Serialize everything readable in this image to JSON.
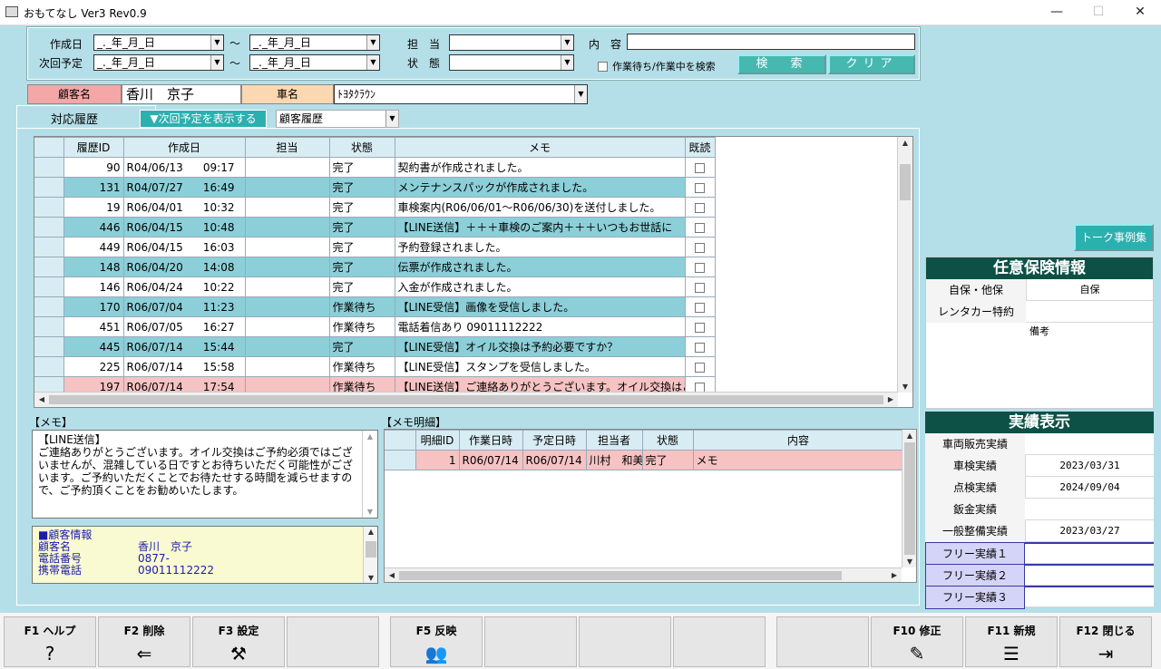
{
  "window": {
    "title": "おもてなし Ver3 Rev0.9",
    "min": "—",
    "max": "☐",
    "close": "✕"
  },
  "search": {
    "created_label": "作成日",
    "next_label": "次回予定",
    "date_placeholder": "_._年_月_日",
    "tilde": "〜",
    "staff_label": "担　当",
    "status_label": "状　態",
    "content_label": "内　容",
    "checkbox_label": "作業待ち/作業中を検索",
    "search_btn": "検　索",
    "clear_btn": "クリア"
  },
  "customer": {
    "name_label": "顧客名",
    "name_value": "香川　京子",
    "car_label": "車名",
    "car_value": "ﾄﾖﾀｸﾗｳﾝ"
  },
  "history": {
    "tab_label": "対応履歴",
    "show_next_btn": "▼次回予定を表示する",
    "filter_value": "顧客履歴",
    "columns": [
      "履歴ID",
      "作成日",
      "担当",
      "状態",
      "メモ",
      "既読"
    ],
    "rows": [
      {
        "id": "90",
        "date": "R04/06/13",
        "time": "09:17",
        "staff": "",
        "status": "完了",
        "memo": "契約書が作成されました。"
      },
      {
        "id": "131",
        "date": "R04/07/27",
        "time": "16:49",
        "staff": "",
        "status": "完了",
        "memo": "メンテナンスパックが作成されました。"
      },
      {
        "id": "19",
        "date": "R06/04/01",
        "time": "10:32",
        "staff": "",
        "status": "完了",
        "memo": "車検案内(R06/06/01〜R06/06/30)を送付しました。"
      },
      {
        "id": "446",
        "date": "R06/04/15",
        "time": "10:48",
        "staff": "",
        "status": "完了",
        "memo": "【LINE送信】＋＋＋車検のご案内＋＋＋いつもお世話に"
      },
      {
        "id": "449",
        "date": "R06/04/15",
        "time": "16:03",
        "staff": "",
        "status": "完了",
        "memo": "予約登録されました。"
      },
      {
        "id": "148",
        "date": "R06/04/20",
        "time": "14:08",
        "staff": "",
        "status": "完了",
        "memo": "伝票が作成されました。"
      },
      {
        "id": "146",
        "date": "R06/04/24",
        "time": "10:22",
        "staff": "",
        "status": "完了",
        "memo": "入金が作成されました。"
      },
      {
        "id": "170",
        "date": "R06/07/04",
        "time": "11:23",
        "staff": "",
        "status": "作業待ち",
        "memo": "【LINE受信】画像を受信しました。"
      },
      {
        "id": "451",
        "date": "R06/07/05",
        "time": "16:27",
        "staff": "",
        "status": "作業待ち",
        "memo": "電話着信あり 09011112222"
      },
      {
        "id": "445",
        "date": "R06/07/14",
        "time": "15:44",
        "staff": "",
        "status": "完了",
        "memo": "【LINE受信】オイル交換は予約必要ですか？"
      },
      {
        "id": "225",
        "date": "R06/07/14",
        "time": "15:58",
        "staff": "",
        "status": "作業待ち",
        "memo": "【LINE受信】スタンプを受信しました。"
      },
      {
        "id": "197",
        "date": "R06/07/14",
        "time": "17:54",
        "staff": "",
        "status": "作業待ち",
        "memo": "【LINE送信】ご連絡ありがとうございます。オイル交換はご"
      }
    ]
  },
  "memo": {
    "label": "【メモ】",
    "text": "【LINE送信】\nご連絡ありがとうございます。オイル交換はご予約必須ではございませんが、混雑している日ですとお待ちいただく可能性がございます。ご予約いただくことでお待たせする時間を減らせますので、ご予約頂くことをお勧めいたします。"
  },
  "customer_info": {
    "title": "■顧客情報",
    "rows": [
      {
        "k": "顧客名",
        "v": "香川　京子"
      },
      {
        "k": "電話番号",
        "v": "0877-"
      },
      {
        "k": "携帯電話",
        "v": "09011112222"
      }
    ]
  },
  "memo_detail": {
    "label": "【メモ明細】",
    "columns": [
      "明細ID",
      "作業日時",
      "予定日時",
      "担当者",
      "状態",
      "内容"
    ],
    "rows": [
      {
        "id": "1",
        "work": "R06/07/14",
        "plan": "R06/07/14",
        "staff": "川村　和美",
        "status": "完了",
        "content": "メモ"
      }
    ]
  },
  "talk_btn": "トーク事例集",
  "insurance": {
    "title": "任意保険情報",
    "rows": [
      {
        "k": "自保・他保",
        "v": "自保"
      },
      {
        "k": "レンタカー特約",
        "v": ""
      }
    ],
    "note_label": "備考"
  },
  "results": {
    "title": "実績表示",
    "rows": [
      {
        "k": "車両販売実績",
        "v": ""
      },
      {
        "k": "車検実績",
        "v": "2023/03/31"
      },
      {
        "k": "点検実績",
        "v": "2024/09/04"
      },
      {
        "k": "鈑金実績",
        "v": ""
      },
      {
        "k": "一般整備実績",
        "v": "2023/03/27"
      }
    ],
    "free": [
      {
        "k": "フリー実績１",
        "v": ""
      },
      {
        "k": "フリー実績２",
        "v": ""
      },
      {
        "k": "フリー実績３",
        "v": ""
      }
    ]
  },
  "fkeys": [
    {
      "label": "F1 ヘルプ",
      "icon": "?",
      "icon_name": "help-icon"
    },
    {
      "label": "F2 削除",
      "icon": "⇐",
      "icon_name": "delete-icon"
    },
    {
      "label": "F3 設定",
      "icon": "⚒",
      "icon_name": "tools-icon"
    },
    {
      "label": "",
      "icon": "",
      "icon_name": ""
    },
    {
      "label": "F5 反映",
      "icon": "👥",
      "icon_name": "users-icon"
    },
    {
      "label": "",
      "icon": "",
      "icon_name": ""
    },
    {
      "label": "",
      "icon": "",
      "icon_name": ""
    },
    {
      "label": "",
      "icon": "",
      "icon_name": ""
    },
    {
      "label": "",
      "icon": "",
      "icon_name": ""
    },
    {
      "label": "F10 修正",
      "icon": "✎",
      "icon_name": "edit-icon"
    },
    {
      "label": "F11 新規",
      "icon": "☰",
      "icon_name": "new-doc-icon"
    },
    {
      "label": "F12 閉じる",
      "icon": "⇥",
      "icon_name": "exit-icon"
    }
  ]
}
